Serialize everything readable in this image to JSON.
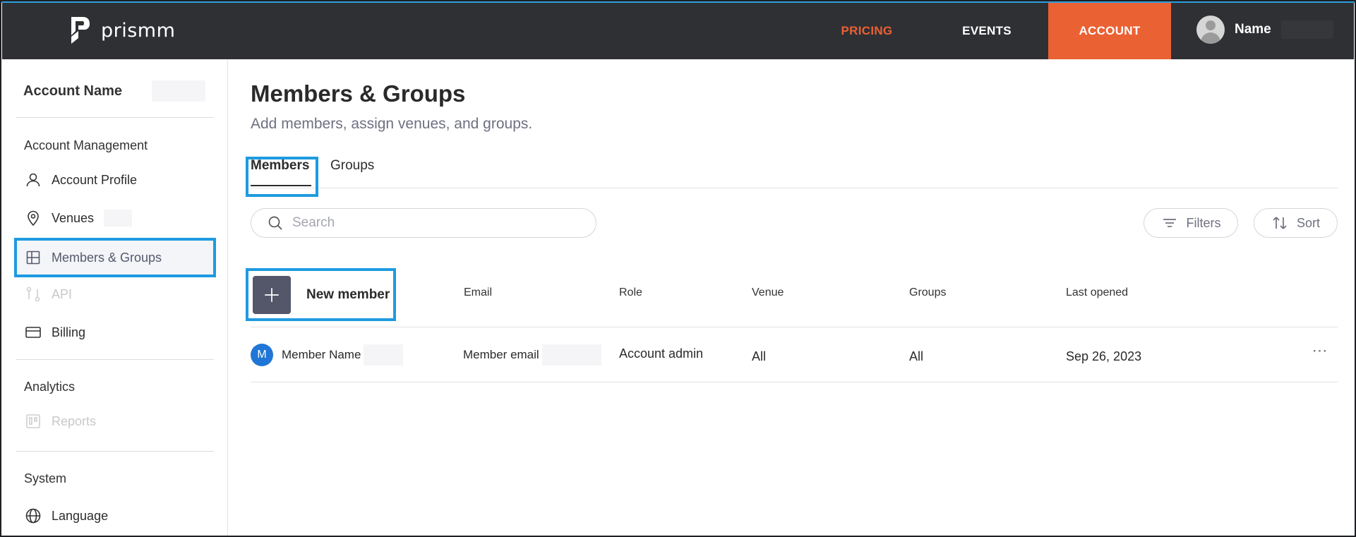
{
  "brand": {
    "name": "prismm"
  },
  "nav": {
    "pricing": "PRICING",
    "events": "EVENTS",
    "account": "ACCOUNT",
    "user_name": "Name"
  },
  "sidebar": {
    "account_name": "Account Name",
    "sections": {
      "account_management": "Account Management",
      "analytics": "Analytics",
      "system": "System"
    },
    "items": [
      {
        "label": "Account Profile",
        "icon": "person-icon"
      },
      {
        "label": "Venues",
        "icon": "map-pin-icon"
      },
      {
        "label": "Members & Groups",
        "icon": "grid-icon",
        "selected": true
      },
      {
        "label": "API",
        "icon": "api-icon",
        "disabled": true
      },
      {
        "label": "Billing",
        "icon": "credit-card-icon"
      },
      {
        "label": "Reports",
        "icon": "reports-icon",
        "disabled": true
      },
      {
        "label": "Language",
        "icon": "globe-icon"
      }
    ]
  },
  "main": {
    "title": "Members & Groups",
    "subtitle": "Add members, assign venues, and groups.",
    "tabs": [
      {
        "label": "Members",
        "active": true
      },
      {
        "label": "Groups",
        "active": false
      }
    ],
    "search": {
      "placeholder": "Search",
      "value": ""
    },
    "filters_label": "Filters",
    "sort_label": "Sort",
    "new_member_label": "New member",
    "columns": [
      "Email",
      "Role",
      "Venue",
      "Groups",
      "Last opened"
    ],
    "rows": [
      {
        "initial": "M",
        "name": "Member Name",
        "email": "Member email",
        "role": "Account admin",
        "venue": "All",
        "groups": "All",
        "last_opened": "Sep 26, 2023",
        "more": "⋯"
      }
    ]
  },
  "colors": {
    "accent": "#ea6133",
    "topbar": "#2f3034",
    "highlight": "#1e9be0",
    "avatar_blue": "#1f76d6"
  }
}
